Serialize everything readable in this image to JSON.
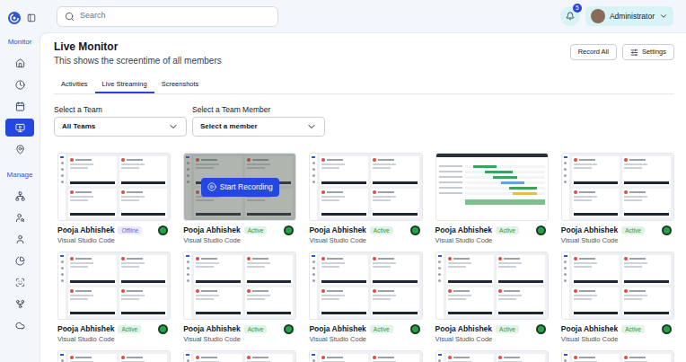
{
  "sidebar": {
    "sections": [
      {
        "label": "Monitor",
        "items": [
          {
            "selected": false
          },
          {
            "selected": false
          },
          {
            "selected": false
          },
          {
            "selected": true
          },
          {
            "selected": false
          }
        ]
      },
      {
        "label": "Manage",
        "items": [
          {
            "selected": false
          },
          {
            "selected": false
          },
          {
            "selected": false
          },
          {
            "selected": false
          },
          {
            "selected": false
          },
          {
            "selected": false
          },
          {
            "selected": false
          }
        ]
      }
    ]
  },
  "search": {
    "placeholder": "Search"
  },
  "notifications": {
    "count": "5"
  },
  "user": {
    "name": "Administrator"
  },
  "page": {
    "title": "Live Monitor",
    "subtitle": "This shows the screentime of all members"
  },
  "actions": [
    "Record All",
    "Settings"
  ],
  "tabs": [
    {
      "label": "Activities",
      "selected": false
    },
    {
      "label": "Live Streaming",
      "selected": true
    },
    {
      "label": "Screenshots",
      "selected": false
    }
  ],
  "filters": [
    {
      "label": "Select a Team",
      "value": "All Teams"
    },
    {
      "label": "Select a Team Member",
      "value": "Select a member"
    }
  ],
  "cards": [
    {
      "name": "Pooja Abhishek",
      "status": "Offline",
      "color": "#6f63d9",
      "app": "Visual Studio Code",
      "thumbnail": "app",
      "hovered": false
    },
    {
      "name": "Pooja Abhishek",
      "status": "Active",
      "color": "#1f9d48",
      "app": "Visual Studio Code",
      "thumbnail": "app",
      "hovered": true,
      "overlay_label": "Start Recording"
    },
    {
      "name": "Pooja Abhishek",
      "status": "Active",
      "color": "#1f9d48",
      "app": "Visual Studio Code",
      "thumbnail": "app",
      "hovered": false
    },
    {
      "name": "Pooja Abhishek",
      "status": "Active",
      "color": "#1f9d48",
      "app": "Visual Studio Code",
      "thumbnail": "table",
      "hovered": false
    },
    {
      "name": "Pooja Abhishek",
      "status": "Active",
      "color": "#1f9d48",
      "app": "Visual Studio Code",
      "thumbnail": "app",
      "hovered": false
    },
    {
      "name": "Pooja Abhishek",
      "status": "Active",
      "color": "#1f9d48",
      "app": "Visual Studio Code",
      "thumbnail": "app",
      "hovered": false
    },
    {
      "name": "Pooja Abhishek",
      "status": "Active",
      "color": "#1f9d48",
      "app": "Visual Studio Code",
      "thumbnail": "app",
      "hovered": false
    },
    {
      "name": "Pooja Abhishek",
      "status": "Active",
      "color": "#1f9d48",
      "app": "Visual Studio Code",
      "thumbnail": "app",
      "hovered": false
    },
    {
      "name": "Pooja Abhishek",
      "status": "Active",
      "color": "#1f9d48",
      "app": "Visual Studio Code",
      "thumbnail": "app",
      "hovered": false
    },
    {
      "name": "Pooja Abhishek",
      "status": "Active",
      "color": "#1f9d48",
      "app": "Visual Studio Code",
      "thumbnail": "app",
      "hovered": false
    },
    {
      "thumbnail": "app",
      "hovered": false
    },
    {
      "thumbnail": "app",
      "hovered": false
    },
    {
      "thumbnail": "app",
      "hovered": false
    },
    {
      "thumbnail": "app",
      "hovered": false
    },
    {
      "thumbnail": "app",
      "hovered": false
    }
  ]
}
